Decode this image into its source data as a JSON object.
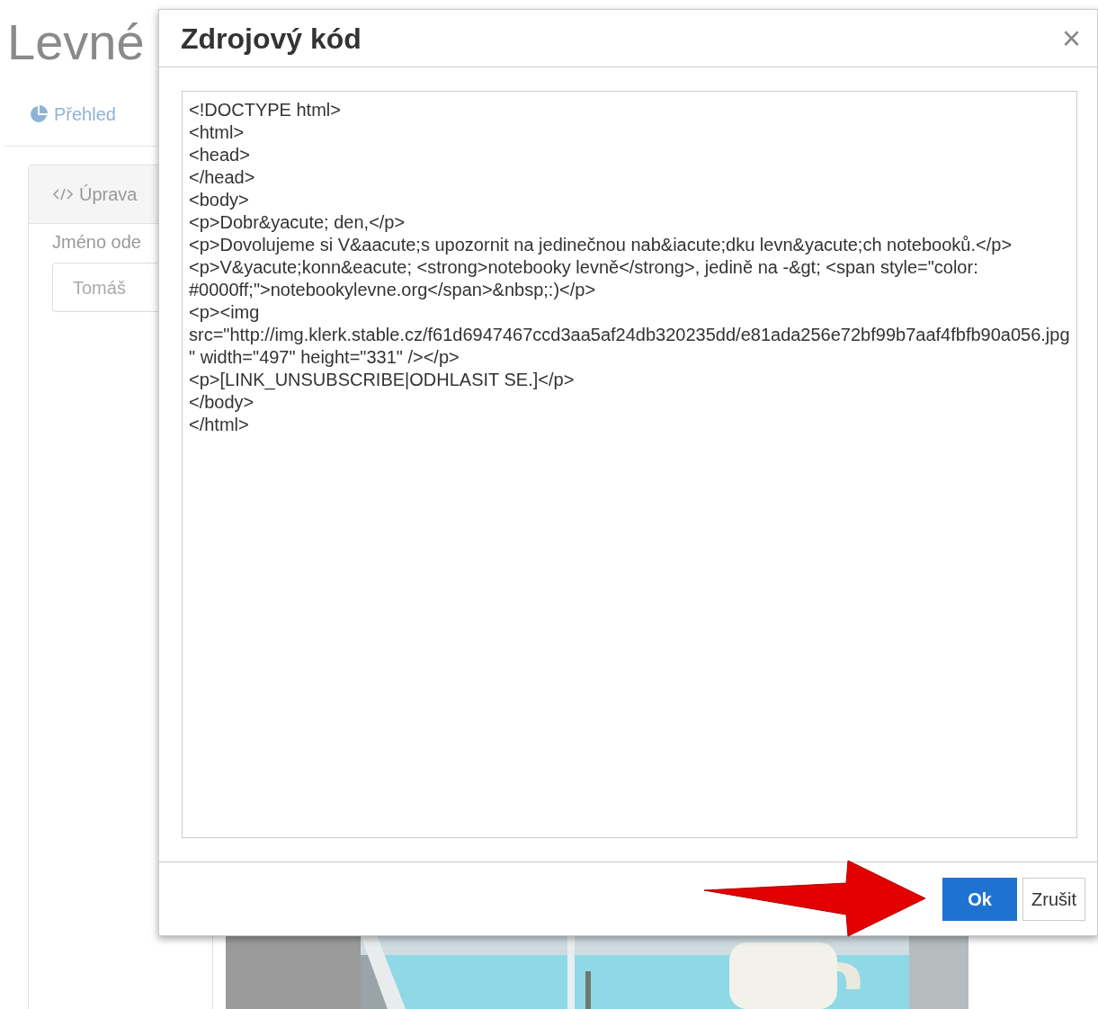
{
  "page": {
    "title": "Levné",
    "nav": [
      {
        "label": "Přehled",
        "selected": false
      }
    ],
    "panel": {
      "heading": "Úprava",
      "field_label": "Jméno ode",
      "field_value": "Tomáš"
    }
  },
  "dialog": {
    "title": "Zdrojový kód",
    "close": "×",
    "code_lines": [
      "<!DOCTYPE html>",
      "<html>",
      "<head>",
      "</head>",
      "<body>",
      "<p>Dobr&yacute; den,</p>",
      "<p>Dovolujeme si V&aacute;s upozornit na jedinečnou nab&iacute;dku levn&yacute;ch notebooků.</p>",
      "<p>V&yacute;konn&eacute; <strong>notebooky levně</strong>, jedině na -&gt; <span style=\"color: #0000ff;\">notebookylevne.org</span>&nbsp;:)</p>",
      "<p><img src=\"http://img.klerk.stable.cz/f61d6947467ccd3aa5af24db320235dd/e81ada256e72bf99b7aaf4fbfb90a056.jpg\" width=\"497\" height=\"331\" /></p>",
      "<p>[LINK_UNSUBSCRIBE|ODHLASIT SE.]</p>",
      "</body>",
      "</html>"
    ],
    "buttons": [
      {
        "label": "Ok",
        "kind": "primary"
      },
      {
        "label": "Zrušit",
        "kind": "secondary"
      }
    ]
  }
}
